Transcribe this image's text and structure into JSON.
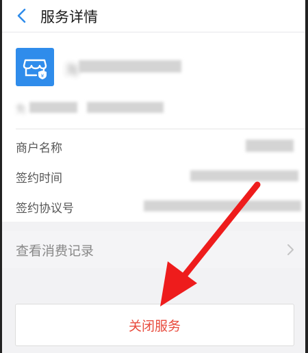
{
  "header": {
    "title": "服务详情",
    "back_icon": "chevron-left-icon"
  },
  "merchant": {
    "logo_icon": "store-icon",
    "logo_color": "#2f8ceb",
    "name": "淘",
    "sub": "免"
  },
  "details": {
    "rows": [
      {
        "label": "商户名称"
      },
      {
        "label": "签约时间"
      },
      {
        "label": "签约协议号"
      }
    ]
  },
  "history": {
    "label": "查看消费记录",
    "icon": "chevron-right-icon"
  },
  "action": {
    "close_label": "关闭服务",
    "color": "#e84a3c"
  },
  "annotation": {
    "arrow_color": "#ee1c1c"
  }
}
